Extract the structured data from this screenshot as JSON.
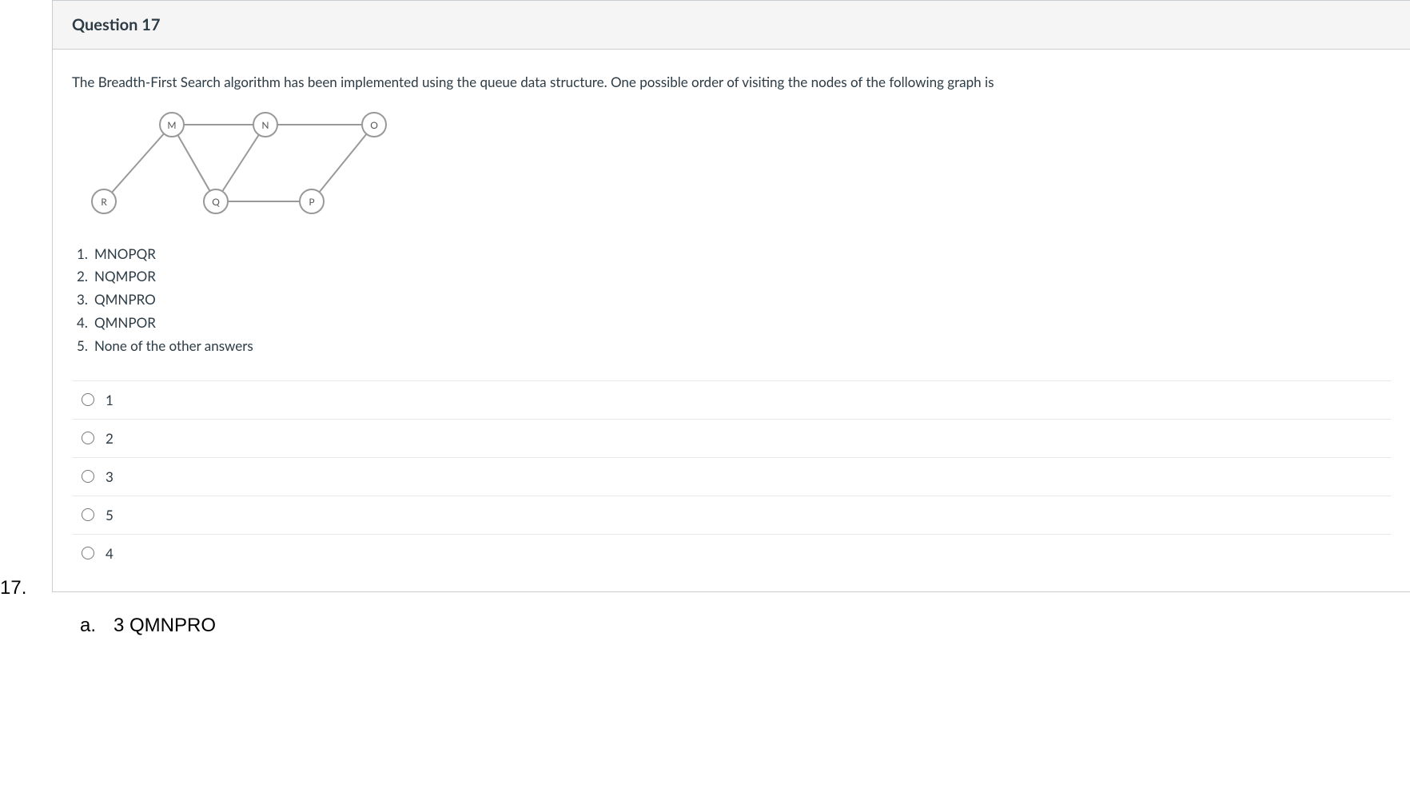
{
  "outerNumber": "17.",
  "header": {
    "title": "Question 17"
  },
  "questionText": "The Breadth-First Search algorithm has been implemented using the queue data structure. One possible order of visiting the nodes of the following graph is",
  "graph": {
    "nodes": {
      "M": "M",
      "N": "N",
      "O": "O",
      "R": "R",
      "Q": "Q",
      "P": "P"
    }
  },
  "options": [
    {
      "num": "1.",
      "text": "MNOPQR"
    },
    {
      "num": "2.",
      "text": "NQMPOR"
    },
    {
      "num": "3.",
      "text": "QMNPRO"
    },
    {
      "num": "4.",
      "text": "QMNPOR"
    },
    {
      "num": "5.",
      "text": "None of the other answers"
    }
  ],
  "radioChoices": [
    "1",
    "2",
    "3",
    "5",
    "4"
  ],
  "bottomAnswer": {
    "letter": "a.",
    "text": "3 QMNPRO"
  }
}
